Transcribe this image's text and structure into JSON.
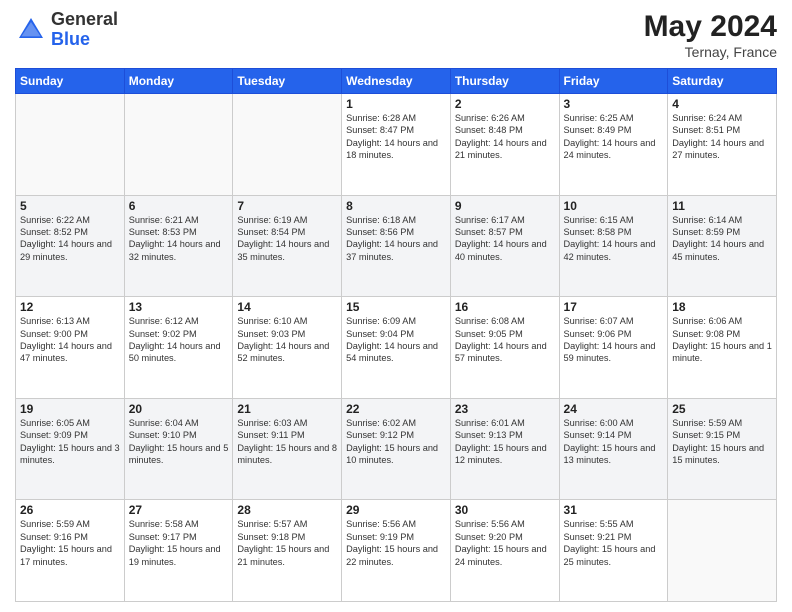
{
  "header": {
    "logo_general": "General",
    "logo_blue": "Blue",
    "month_year": "May 2024",
    "location": "Ternay, France"
  },
  "days_of_week": [
    "Sunday",
    "Monday",
    "Tuesday",
    "Wednesday",
    "Thursday",
    "Friday",
    "Saturday"
  ],
  "weeks": [
    [
      {
        "day": "",
        "info": ""
      },
      {
        "day": "",
        "info": ""
      },
      {
        "day": "",
        "info": ""
      },
      {
        "day": "1",
        "info": "Sunrise: 6:28 AM\nSunset: 8:47 PM\nDaylight: 14 hours and 18 minutes."
      },
      {
        "day": "2",
        "info": "Sunrise: 6:26 AM\nSunset: 8:48 PM\nDaylight: 14 hours and 21 minutes."
      },
      {
        "day": "3",
        "info": "Sunrise: 6:25 AM\nSunset: 8:49 PM\nDaylight: 14 hours and 24 minutes."
      },
      {
        "day": "4",
        "info": "Sunrise: 6:24 AM\nSunset: 8:51 PM\nDaylight: 14 hours and 27 minutes."
      }
    ],
    [
      {
        "day": "5",
        "info": "Sunrise: 6:22 AM\nSunset: 8:52 PM\nDaylight: 14 hours and 29 minutes."
      },
      {
        "day": "6",
        "info": "Sunrise: 6:21 AM\nSunset: 8:53 PM\nDaylight: 14 hours and 32 minutes."
      },
      {
        "day": "7",
        "info": "Sunrise: 6:19 AM\nSunset: 8:54 PM\nDaylight: 14 hours and 35 minutes."
      },
      {
        "day": "8",
        "info": "Sunrise: 6:18 AM\nSunset: 8:56 PM\nDaylight: 14 hours and 37 minutes."
      },
      {
        "day": "9",
        "info": "Sunrise: 6:17 AM\nSunset: 8:57 PM\nDaylight: 14 hours and 40 minutes."
      },
      {
        "day": "10",
        "info": "Sunrise: 6:15 AM\nSunset: 8:58 PM\nDaylight: 14 hours and 42 minutes."
      },
      {
        "day": "11",
        "info": "Sunrise: 6:14 AM\nSunset: 8:59 PM\nDaylight: 14 hours and 45 minutes."
      }
    ],
    [
      {
        "day": "12",
        "info": "Sunrise: 6:13 AM\nSunset: 9:00 PM\nDaylight: 14 hours and 47 minutes."
      },
      {
        "day": "13",
        "info": "Sunrise: 6:12 AM\nSunset: 9:02 PM\nDaylight: 14 hours and 50 minutes."
      },
      {
        "day": "14",
        "info": "Sunrise: 6:10 AM\nSunset: 9:03 PM\nDaylight: 14 hours and 52 minutes."
      },
      {
        "day": "15",
        "info": "Sunrise: 6:09 AM\nSunset: 9:04 PM\nDaylight: 14 hours and 54 minutes."
      },
      {
        "day": "16",
        "info": "Sunrise: 6:08 AM\nSunset: 9:05 PM\nDaylight: 14 hours and 57 minutes."
      },
      {
        "day": "17",
        "info": "Sunrise: 6:07 AM\nSunset: 9:06 PM\nDaylight: 14 hours and 59 minutes."
      },
      {
        "day": "18",
        "info": "Sunrise: 6:06 AM\nSunset: 9:08 PM\nDaylight: 15 hours and 1 minute."
      }
    ],
    [
      {
        "day": "19",
        "info": "Sunrise: 6:05 AM\nSunset: 9:09 PM\nDaylight: 15 hours and 3 minutes."
      },
      {
        "day": "20",
        "info": "Sunrise: 6:04 AM\nSunset: 9:10 PM\nDaylight: 15 hours and 5 minutes."
      },
      {
        "day": "21",
        "info": "Sunrise: 6:03 AM\nSunset: 9:11 PM\nDaylight: 15 hours and 8 minutes."
      },
      {
        "day": "22",
        "info": "Sunrise: 6:02 AM\nSunset: 9:12 PM\nDaylight: 15 hours and 10 minutes."
      },
      {
        "day": "23",
        "info": "Sunrise: 6:01 AM\nSunset: 9:13 PM\nDaylight: 15 hours and 12 minutes."
      },
      {
        "day": "24",
        "info": "Sunrise: 6:00 AM\nSunset: 9:14 PM\nDaylight: 15 hours and 13 minutes."
      },
      {
        "day": "25",
        "info": "Sunrise: 5:59 AM\nSunset: 9:15 PM\nDaylight: 15 hours and 15 minutes."
      }
    ],
    [
      {
        "day": "26",
        "info": "Sunrise: 5:59 AM\nSunset: 9:16 PM\nDaylight: 15 hours and 17 minutes."
      },
      {
        "day": "27",
        "info": "Sunrise: 5:58 AM\nSunset: 9:17 PM\nDaylight: 15 hours and 19 minutes."
      },
      {
        "day": "28",
        "info": "Sunrise: 5:57 AM\nSunset: 9:18 PM\nDaylight: 15 hours and 21 minutes."
      },
      {
        "day": "29",
        "info": "Sunrise: 5:56 AM\nSunset: 9:19 PM\nDaylight: 15 hours and 22 minutes."
      },
      {
        "day": "30",
        "info": "Sunrise: 5:56 AM\nSunset: 9:20 PM\nDaylight: 15 hours and 24 minutes."
      },
      {
        "day": "31",
        "info": "Sunrise: 5:55 AM\nSunset: 9:21 PM\nDaylight: 15 hours and 25 minutes."
      },
      {
        "day": "",
        "info": ""
      }
    ]
  ]
}
